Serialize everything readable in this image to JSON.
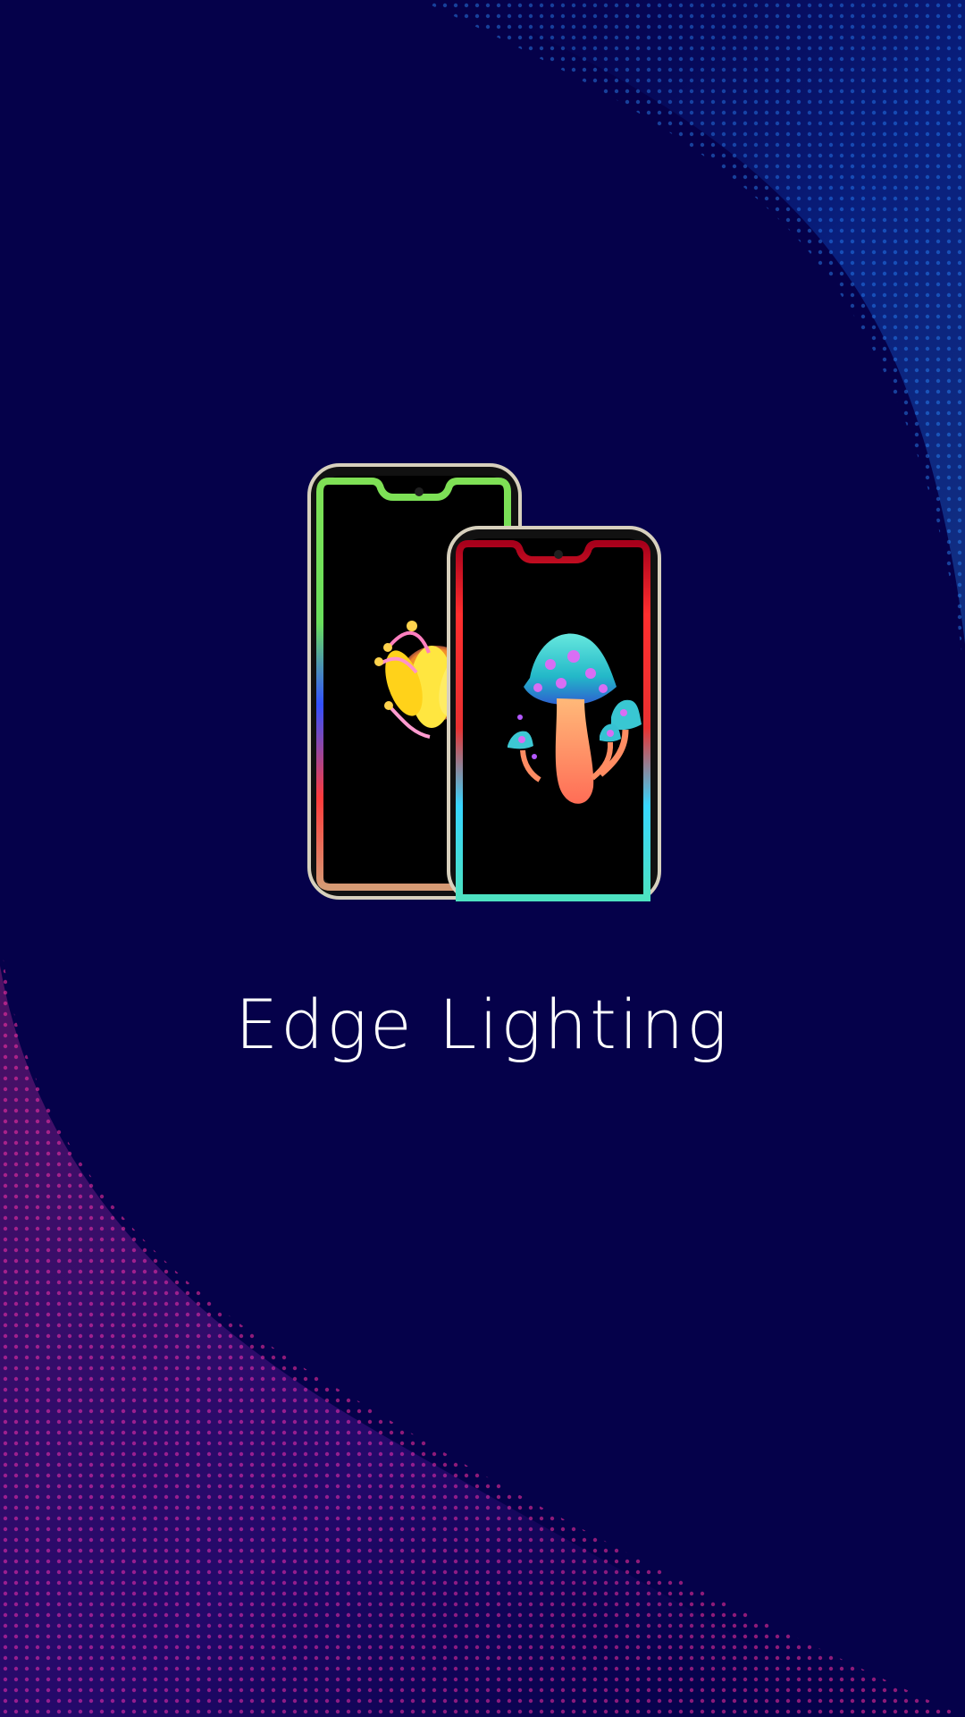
{
  "app": {
    "title": "Edge Lighting"
  },
  "theme": {
    "background": "#05014a",
    "wave_top_color": "#1f8bff",
    "wave_bottom_color": "#ff2f96",
    "phone_frame_color": "#d7d0bd"
  },
  "illustration": {
    "left_phone_art": "glowing-flower-icon",
    "right_phone_art": "glowing-mushroom-icon"
  }
}
